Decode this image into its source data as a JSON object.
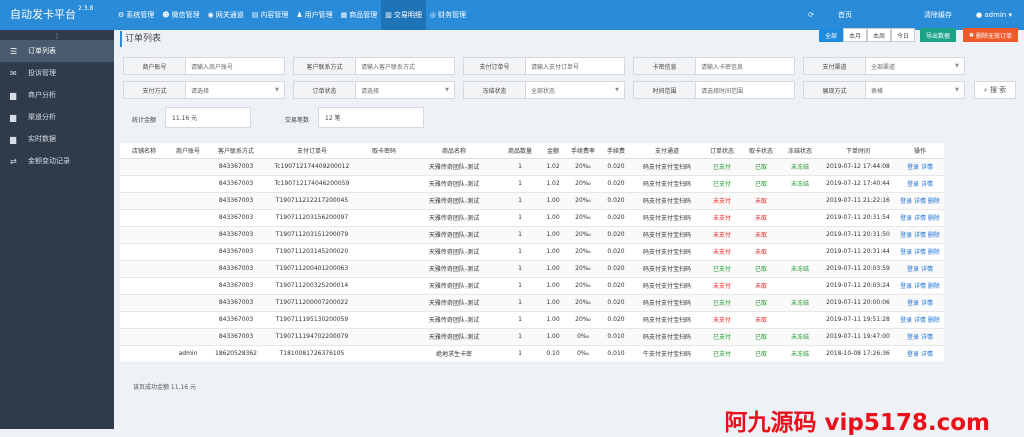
{
  "app": {
    "title": "自动发卡平台",
    "version": "2.3.8"
  },
  "topnav": [
    {
      "label": "系统管理",
      "icon": "gear-icon"
    },
    {
      "label": "微信管理",
      "icon": "wechat-icon"
    },
    {
      "label": "网关通道",
      "icon": "globe-icon"
    },
    {
      "label": "内容管理",
      "icon": "doc-icon"
    },
    {
      "label": "用户管理",
      "icon": "users-icon"
    },
    {
      "label": "商品管理",
      "icon": "box-icon"
    },
    {
      "label": "交易明细",
      "icon": "chart-icon",
      "active": true
    },
    {
      "label": "财务管理",
      "icon": "coin-icon"
    }
  ],
  "topright": {
    "refresh_icon": "refresh-icon",
    "home": "首页",
    "blurred": "",
    "clear_cache": "清除缓存",
    "user": "admin"
  },
  "sidebar": [
    {
      "label": "订单列表",
      "active": true
    },
    {
      "label": "投诉管理"
    },
    {
      "label": "商户分析"
    },
    {
      "label": "渠道分析"
    },
    {
      "label": "实时数据"
    },
    {
      "label": "金额变动记录"
    }
  ],
  "page": {
    "title": "订单列表"
  },
  "toolbar": {
    "ranges": [
      "全部",
      "本月",
      "本周",
      "今日"
    ],
    "export": "导出数据",
    "delete_invalid": "删除无效订单"
  },
  "filters": {
    "row1": [
      {
        "label": "商户账号",
        "placeholder": "请输入商户账号"
      },
      {
        "label": "客户联系方式",
        "placeholder": "请输入客户联系方式"
      },
      {
        "label": "支付订单号",
        "placeholder": "请输入支付订单号"
      },
      {
        "label": "卡密信息",
        "placeholder": "请输入卡密信息"
      },
      {
        "label": "支付渠道",
        "placeholder": "全部渠道",
        "select": true
      }
    ],
    "row2": [
      {
        "label": "支付方式",
        "placeholder": "请选择",
        "select": true
      },
      {
        "label": "订单状态",
        "placeholder": "请选择",
        "select": true
      },
      {
        "label": "冻结状态",
        "placeholder": "全部状态",
        "select": true
      },
      {
        "label": "时间范围",
        "placeholder": "请选择时间范围"
      },
      {
        "label": "展现方式",
        "placeholder": "表格",
        "select": true
      }
    ],
    "search": "搜 索"
  },
  "stats": {
    "amount_label": "统计金额",
    "amount": "11.16 元",
    "count_label": "交易笔数",
    "count": "12 笔"
  },
  "table": {
    "headers": [
      "店铺名称",
      "商户账号",
      "客户联系方式",
      "支付订单号",
      "取卡密码",
      "商品名称",
      "商品数量",
      "金额",
      "手续费率",
      "手续费",
      "支付通道",
      "订单状态",
      "取卡状态",
      "冻结状态",
      "下单时间",
      "操作"
    ],
    "rows": [
      [
        "",
        "",
        "843367003",
        "Tc190712174409200012",
        "",
        "天雅传奇团队-测试",
        "1",
        "1.02",
        "20‰",
        "0.020",
        "码支付支付宝扫码",
        "已支付",
        "已取",
        "未冻结",
        "2019-07-12 17:44:08",
        "登录 详情"
      ],
      [
        "",
        "",
        "843367003",
        "Tc190712174046200059",
        "",
        "天雅传奇团队-测试",
        "1",
        "1.02",
        "20‰",
        "0.020",
        "码支付支付宝扫码",
        "已支付",
        "已取",
        "未冻结",
        "2019-07-12 17:40:44",
        "登录 详情"
      ],
      [
        "",
        "",
        "843367003",
        "T190711212217200045",
        "",
        "天雅传奇团队-测试",
        "1",
        "1.00",
        "20‰",
        "0.020",
        "码支付支付宝扫码",
        "未支付",
        "未取",
        "",
        "2019-07-11 21:22:16",
        "登录 详情 删除"
      ],
      [
        "",
        "",
        "843367003",
        "T190711203156200097",
        "",
        "天雅传奇团队-测试",
        "1",
        "1.00",
        "20‰",
        "0.020",
        "码支付支付宝扫码",
        "未支付",
        "未取",
        "",
        "2019-07-11 20:31:54",
        "登录 详情 删除"
      ],
      [
        "",
        "",
        "843367003",
        "T190711203151200079",
        "",
        "天雅传奇团队-测试",
        "1",
        "1.00",
        "20‰",
        "0.020",
        "码支付支付宝扫码",
        "未支付",
        "未取",
        "",
        "2019-07-11 20:31:50",
        "登录 详情 删除"
      ],
      [
        "",
        "",
        "843367003",
        "T190711203145200020",
        "",
        "天雅传奇团队-测试",
        "1",
        "1.00",
        "20‰",
        "0.020",
        "码支付支付宝扫码",
        "未支付",
        "未取",
        "",
        "2019-07-11 20:31:44",
        "登录 详情 删除"
      ],
      [
        "",
        "",
        "843367003",
        "T190711200401200063",
        "",
        "天雅传奇团队-测试",
        "1",
        "1.00",
        "20‰",
        "0.020",
        "码支付支付宝扫码",
        "已支付",
        "已取",
        "未冻结",
        "2019-07-11 20:03:59",
        "登录 详情"
      ],
      [
        "",
        "",
        "843367003",
        "T190711200325200014",
        "",
        "天雅传奇团队-测试",
        "1",
        "1.00",
        "20‰",
        "0.020",
        "码支付支付宝扫码",
        "未支付",
        "未取",
        "",
        "2019-07-11 20:03:24",
        "登录 详情 删除"
      ],
      [
        "",
        "",
        "843367003",
        "T190711200007200022",
        "",
        "天雅传奇团队-测试",
        "1",
        "1.00",
        "20‰",
        "0.020",
        "码支付支付宝扫码",
        "已支付",
        "已取",
        "未冻结",
        "2019-07-11 20:00:06",
        "登录 详情"
      ],
      [
        "",
        "",
        "843367003",
        "T190711195130200059",
        "",
        "天雅传奇团队-测试",
        "1",
        "1.00",
        "20‰",
        "0.020",
        "码支付支付宝扫码",
        "未支付",
        "未取",
        "",
        "2019-07-11 19:51:28",
        "登录 详情 删除"
      ],
      [
        "",
        "",
        "843367003",
        "T190711194702200079",
        "",
        "天雅传奇团队-测试",
        "1",
        "1.00",
        "0‰",
        "0.010",
        "码支付支付宝扫码",
        "已支付",
        "已取",
        "未冻结",
        "2019-07-11 19:47:00",
        "登录 详情"
      ],
      [
        "",
        "admin",
        "18620528362",
        "T1810081726376105",
        "",
        "绝地求生卡密",
        "1",
        "0.10",
        "0‰",
        "0.010",
        "牛支付支付宝扫码",
        "已支付",
        "已取",
        "未冻结",
        "2018-10-08 17:26:36",
        "登录 详情"
      ]
    ]
  },
  "footer": {
    "note": "该页成功金额 11.16 元"
  },
  "watermark": "阿九源码 vip5178.com",
  "colors": {
    "topbar": "#2a8bd8",
    "sidebar": "#2f3b4a",
    "paid": "#1a9a2a",
    "unpaid": "#e22222",
    "link": "#1d6fd0"
  }
}
